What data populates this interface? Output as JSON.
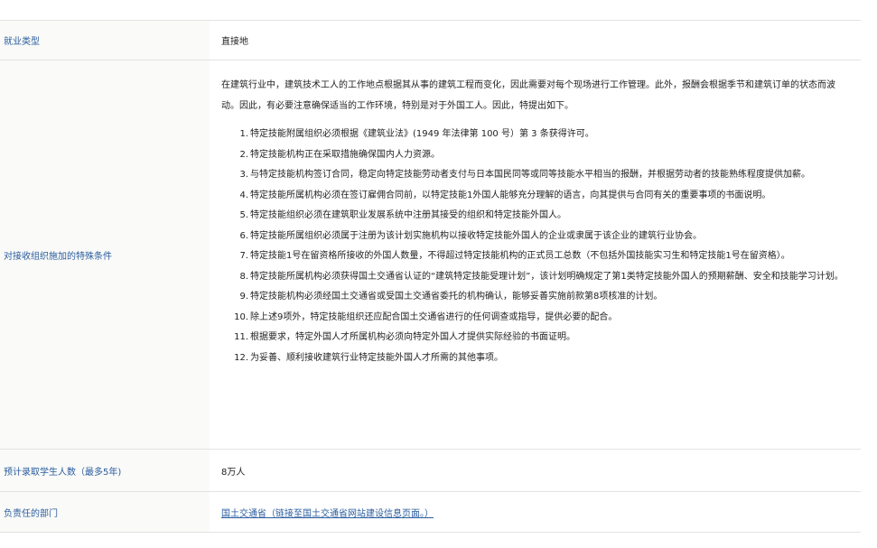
{
  "rows": {
    "employment_type": {
      "label": "就业类型",
      "value": "直接地"
    },
    "special_conditions": {
      "label": "对接收组织施加的特殊条件",
      "intro": "在建筑行业中，建筑技术工人的工作地点根据其从事的建筑工程而变化，因此需要对每个现场进行工作管理。此外，报酬会根据季节和建筑订单的状态而波动。因此，有必要注意确保适当的工作环境，特别是对于外国工人。因此，特提出如下。",
      "items": [
        {
          "num": "1.",
          "text": "特定技能附属组织必须根据《建筑业法》(1949 年法律第 100 号）第 3 条获得许可。"
        },
        {
          "num": "2.",
          "text": "特定技能机构正在采取措施确保国内人力资源。"
        },
        {
          "num": "3.",
          "text": "与特定技能机构签订合同，稳定向特定技能劳动者支付与日本国民同等或同等技能水平相当的报酬，并根据劳动者的技能熟练程度提供加薪。"
        },
        {
          "num": "4.",
          "text": "特定技能所属机构必须在签订雇佣合同前，以特定技能1外国人能够充分理解的语言，向其提供与合同有关的重要事项的书面说明。"
        },
        {
          "num": "5.",
          "text": "特定技能组织必须在建筑职业发展系统中注册其接受的组织和特定技能外国人。"
        },
        {
          "num": "6.",
          "text": "特定技能所属组织必须属于注册为该计划实施机构以接收特定技能外国人的企业或隶属于该企业的建筑行业协会。"
        },
        {
          "num": "7.",
          "text": "特定技能1号在留资格所接收的外国人数量，不得超过特定技能机构的正式员工总数（不包括外国技能实习生和特定技能1号在留资格）。"
        },
        {
          "num": "8.",
          "text": "特定技能所属机构必须获得国土交通省认证的“建筑特定技能受理计划”，该计划明确规定了第1类特定技能外国人的预期薪酬、安全和技能学习计划。"
        },
        {
          "num": "9.",
          "text": "特定技能机构必须经国土交通省或受国土交通省委托的机构确认，能够妥善实施前款第8项核准的计划。"
        },
        {
          "num": "10.",
          "text": "除上述9项外，特定技能组织还应配合国土交通省进行的任何调查或指导，提供必要的配合。"
        },
        {
          "num": "11.",
          "text": "根据要求，特定外国人才所属机构必须向特定外国人才提供实际经验的书面证明。"
        },
        {
          "num": "12.",
          "text": "为妥善、顺利接收建筑行业特定技能外国人才所需的其他事项。"
        }
      ]
    },
    "expected_students": {
      "label": "预计录取学生人数（最多5年)",
      "value": "8万人"
    },
    "responsible_department": {
      "label": "负责任的部门",
      "link_text": "国土交通省（链接至国土交通省网站建设信息页面。）"
    }
  },
  "colors": {
    "label_text": "#2a5d9f",
    "label_background": "#fafaf8",
    "border": "#e3e3e3",
    "body_text": "#222222"
  }
}
